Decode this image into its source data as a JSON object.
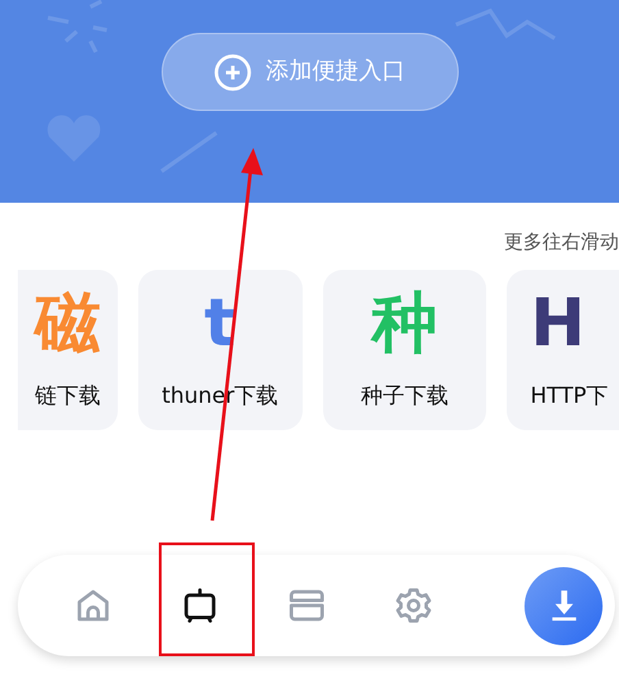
{
  "header": {
    "add_button": {
      "label": "添加便捷入口"
    }
  },
  "hint": "更多往右滑动",
  "cards": [
    {
      "glyph": "磁",
      "label": "链下载",
      "color": "#f98a32",
      "kind": "cut-left"
    },
    {
      "glyph": "t",
      "label": "thuner下载",
      "color": "#5180e8",
      "kind": "full"
    },
    {
      "glyph": "种",
      "label": "种子下载",
      "color": "#22c064",
      "kind": "full"
    },
    {
      "glyph": "H",
      "label": "HTTP下",
      "color": "#3d3b78",
      "kind": "cut-right"
    }
  ],
  "nav": [
    {
      "kind": "home",
      "selected": false
    },
    {
      "kind": "tv",
      "selected": true
    },
    {
      "kind": "cards",
      "selected": false
    },
    {
      "kind": "settings",
      "selected": false
    },
    {
      "kind": "download",
      "selected": false
    }
  ]
}
